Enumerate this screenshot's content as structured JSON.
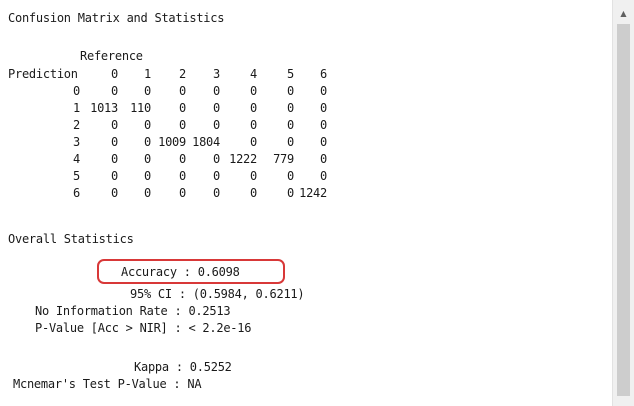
{
  "console": {
    "title": "Confusion Matrix and Statistics",
    "reference_label": "Reference",
    "prediction_label": "Prediction",
    "column_headers": [
      "0",
      "1",
      "2",
      "3",
      "4",
      "5",
      "6"
    ],
    "rows": [
      {
        "label": "0",
        "values": [
          "0",
          "0",
          "0",
          "0",
          "0",
          "0",
          "0"
        ]
      },
      {
        "label": "1",
        "values": [
          "1013",
          "110",
          "0",
          "0",
          "0",
          "0",
          "0"
        ]
      },
      {
        "label": "2",
        "values": [
          "0",
          "0",
          "0",
          "0",
          "0",
          "0",
          "0"
        ]
      },
      {
        "label": "3",
        "values": [
          "0",
          "0",
          "1009",
          "1804",
          "0",
          "0",
          "0"
        ]
      },
      {
        "label": "4",
        "values": [
          "0",
          "0",
          "0",
          "0",
          "1222",
          "779",
          "0"
        ]
      },
      {
        "label": "5",
        "values": [
          "0",
          "0",
          "0",
          "0",
          "0",
          "0",
          "0"
        ]
      },
      {
        "label": "6",
        "values": [
          "0",
          "0",
          "0",
          "0",
          "0",
          "0",
          "1242"
        ]
      }
    ],
    "overall_heading": "Overall Statistics",
    "stats": {
      "accuracy": "Accuracy : 0.6098",
      "ci": "95% CI : (0.5984, 0.6211)",
      "nir": "No Information Rate : 0.2513",
      "pvalue": "P-Value [Acc > NIR] : < 2.2e-16",
      "kappa": "Kappa : 0.5252",
      "mcnemar": "Mcnemar's Test P-Value : NA"
    }
  },
  "scrollbar": {
    "up_arrow": "▲"
  },
  "colors": {
    "highlight": "#d83838",
    "scroll_thumb": "#cdcdcd"
  }
}
